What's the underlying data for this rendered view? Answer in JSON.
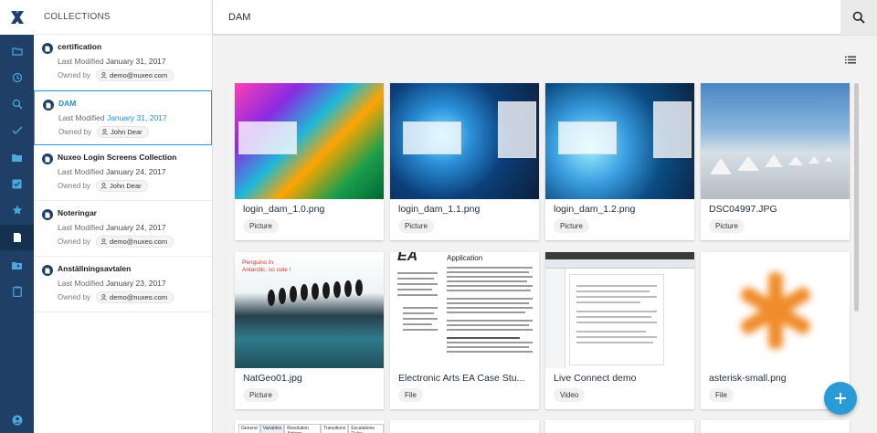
{
  "header": {
    "title": "DAM"
  },
  "collections": {
    "heading": "COLLECTIONS",
    "items": [
      {
        "title": "certification",
        "modified_label": "Last Modified",
        "modified_date": "January 31, 2017",
        "owned_label": "Owned by",
        "owner": "demo@nuxeo.com",
        "selected": false
      },
      {
        "title": "DAM",
        "modified_label": "Last Modified",
        "modified_date": "January 31, 2017",
        "owned_label": "Owned by",
        "owner": "John Dear",
        "selected": true
      },
      {
        "title": "Nuxeo Login Screens Collection",
        "modified_label": "Last Modified",
        "modified_date": "January 24, 2017",
        "owned_label": "Owned by",
        "owner": "John Dear",
        "selected": false
      },
      {
        "title": "Noteringar",
        "modified_label": "Last Modified",
        "modified_date": "January 24, 2017",
        "owned_label": "Owned by",
        "owner": "demo@nuxeo.com",
        "selected": false
      },
      {
        "title": "Anställningsavtalen",
        "modified_label": "Last Modified",
        "modified_date": "January 23, 2017",
        "owned_label": "Owned by",
        "owner": "demo@nuxeo.com",
        "selected": false
      }
    ]
  },
  "rail": {
    "icons": [
      "folder-icon",
      "history-icon",
      "search-icon",
      "check-icon",
      "folder-copy-icon",
      "task-icon",
      "star-icon",
      "collections-icon",
      "folder-shared-icon",
      "clipboard-icon",
      "user-icon"
    ]
  },
  "cards": [
    {
      "title": "login_dam_1.0.png",
      "type": "Picture"
    },
    {
      "title": "login_dam_1.1.png",
      "type": "Picture"
    },
    {
      "title": "login_dam_1.2.png",
      "type": "Picture"
    },
    {
      "title": "DSC04997.JPG",
      "type": "Picture"
    },
    {
      "title": "NatGeo01.jpg",
      "type": "Picture"
    },
    {
      "title": "Electronic Arts EA Case Stu...",
      "type": "File"
    },
    {
      "title": "Live Connect demo",
      "type": "Video"
    },
    {
      "title": "asterisk-small.png",
      "type": "File"
    }
  ],
  "thumb_text": {
    "penguins": "Penguins in Antarctic, so cute !",
    "doc_heading": "Application",
    "doc_ea": "EA",
    "tabs": [
      "General",
      "Variables",
      "Resolution Actions",
      "Transitions",
      "Escalations Rules"
    ]
  },
  "colors": {
    "rail": "#1f3f66",
    "accent": "#2a9bd6",
    "selected_text": "#1e90d2"
  }
}
